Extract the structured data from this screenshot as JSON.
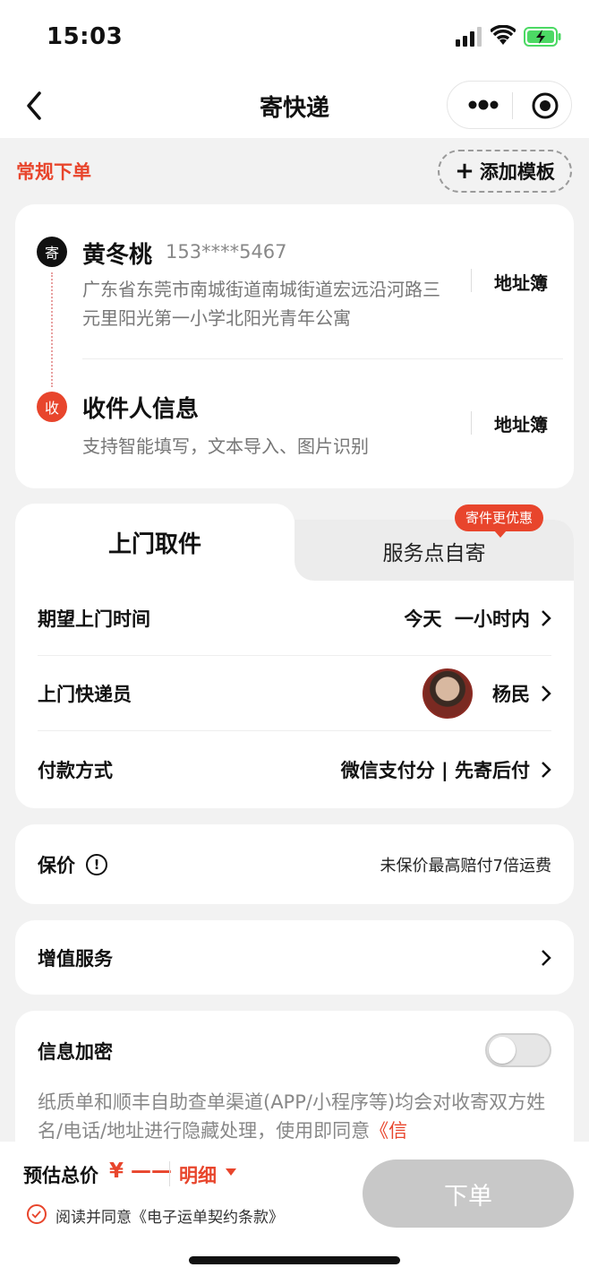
{
  "status_bar": {
    "time": "15:03"
  },
  "nav": {
    "title": "寄快递"
  },
  "order_mode": {
    "label": "常规下单",
    "add_template": "添加模板"
  },
  "sender": {
    "badge": "寄",
    "name": "黄冬桃",
    "phone": "153****5467",
    "address": "广东省东莞市南城街道南城街道宏远沿河路三元里阳光第一小学北阳光青年公寓",
    "address_book": "地址簿"
  },
  "receiver": {
    "badge": "收",
    "title": "收件人信息",
    "subtitle": "支持智能填写，文本导入、图片识别",
    "address_book": "地址簿"
  },
  "pickup": {
    "tabs": [
      {
        "label": "上门取件",
        "active": true
      },
      {
        "label": "服务点自寄",
        "active": false
      }
    ],
    "promo_badge": "寄件更优惠",
    "rows": [
      {
        "label": "期望上门时间",
        "value": "今天  一小时内"
      },
      {
        "label": "上门快递员",
        "value": "杨民"
      },
      {
        "label": "付款方式",
        "value": "微信支付分 | 先寄后付"
      }
    ]
  },
  "insurance": {
    "label": "保价",
    "value": "未保价最高赔付7倍运费"
  },
  "value_added": {
    "label": "增值服务"
  },
  "encryption": {
    "label": "信息加密",
    "enabled": false,
    "description": "纸质单和顺丰自助查单渠道(APP/小程序等)均会对收寄双方姓名/电话/地址进行隐藏处理，使用即同意",
    "link_text": "《信"
  },
  "bottom_bar": {
    "estimate_label": "预估总价",
    "price": "¥ ——",
    "detail": "明细",
    "agreement": "阅读并同意《电子运单契约条款》",
    "submit": "下单"
  },
  "colors": {
    "accent": "#e8452c",
    "background": "#f2f2f2",
    "button_disabled": "#c8c8c8"
  }
}
